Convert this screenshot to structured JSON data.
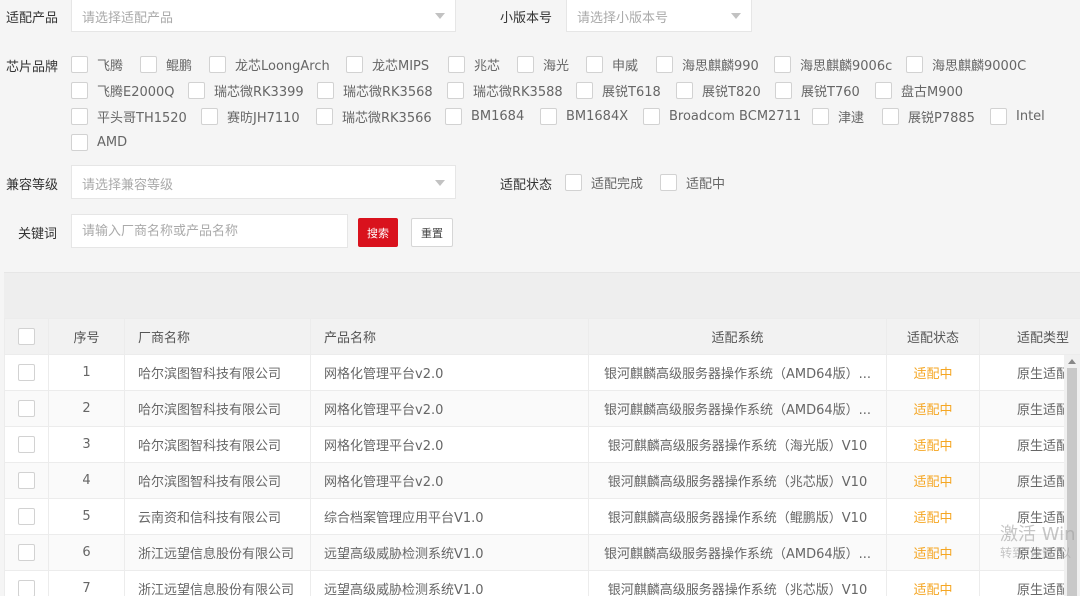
{
  "filters": {
    "product_label": "适配产品",
    "product_placeholder": "请选择适配产品",
    "version_label": "小版本号",
    "version_placeholder": "请选择小版本号",
    "chip_label": "芯片品牌",
    "chips": [
      "飞腾",
      "鲲鹏",
      "龙芯LoongArch",
      "龙芯MIPS",
      "兆芯",
      "海光",
      "申威",
      "海思麒麟990",
      "海思麒麟9006c",
      "海思麒麟9000C",
      "飞腾E2000Q",
      "瑞芯微RK3399",
      "瑞芯微RK3568",
      "瑞芯微RK3588",
      "展锐T618",
      "展锐T820",
      "展锐T760",
      "盘古M900",
      "平头哥TH1520",
      "赛昉JH7110",
      "瑞芯微RK3566",
      "BM1684",
      "BM1684X",
      "Broadcom BCM2711",
      "津逮",
      "展锐P7885",
      "Intel",
      "AMD"
    ],
    "level_label": "兼容等级",
    "level_placeholder": "请选择兼容等级",
    "status_label": "适配状态",
    "status_options": [
      "适配完成",
      "适配中"
    ],
    "keyword_label": "关键词",
    "keyword_placeholder": "请输入厂商名称或产品名称",
    "search_button": "搜索",
    "reset_button": "重置"
  },
  "table": {
    "headers": [
      "序号",
      "厂商名称",
      "产品名称",
      "适配系统",
      "适配状态",
      "适配类型"
    ],
    "rows": [
      {
        "no": "1",
        "vendor": "哈尔滨图智科技有限公司",
        "product": "网格化管理平台v2.0",
        "os": "银河麒麟高级服务器操作系统（AMD64版）...",
        "status": "适配中",
        "type": "原生适配"
      },
      {
        "no": "2",
        "vendor": "哈尔滨图智科技有限公司",
        "product": "网格化管理平台v2.0",
        "os": "银河麒麟高级服务器操作系统（AMD64版）...",
        "status": "适配中",
        "type": "原生适配"
      },
      {
        "no": "3",
        "vendor": "哈尔滨图智科技有限公司",
        "product": "网格化管理平台v2.0",
        "os": "银河麒麟高级服务器操作系统（海光版）V10",
        "status": "适配中",
        "type": "原生适配"
      },
      {
        "no": "4",
        "vendor": "哈尔滨图智科技有限公司",
        "product": "网格化管理平台v2.0",
        "os": "银河麒麟高级服务器操作系统（兆芯版）V10",
        "status": "适配中",
        "type": "原生适配"
      },
      {
        "no": "5",
        "vendor": "云南资和信科技有限公司",
        "product": "综合档案管理应用平台V1.0",
        "os": "银河麒麟高级服务器操作系统（鲲鹏版）V10",
        "status": "适配中",
        "type": "原生适配"
      },
      {
        "no": "6",
        "vendor": "浙江远望信息股份有限公司",
        "product": "远望高级威胁检测系统V1.0",
        "os": "银河麒麟高级服务器操作系统（AMD64版）...",
        "status": "适配中",
        "type": "原生适配"
      },
      {
        "no": "7",
        "vendor": "浙江远望信息股份有限公司",
        "product": "远望高级威胁检测系统V1.0",
        "os": "银河麒麟高级服务器操作系统（兆芯版）V10",
        "status": "适配中",
        "type": "原生适配"
      }
    ]
  },
  "watermark": {
    "line1": "激活 Win",
    "line2": "转到\"设置\"以"
  },
  "colors": {
    "status_in_progress": "#f5a623",
    "search_button": "#d9121d"
  }
}
